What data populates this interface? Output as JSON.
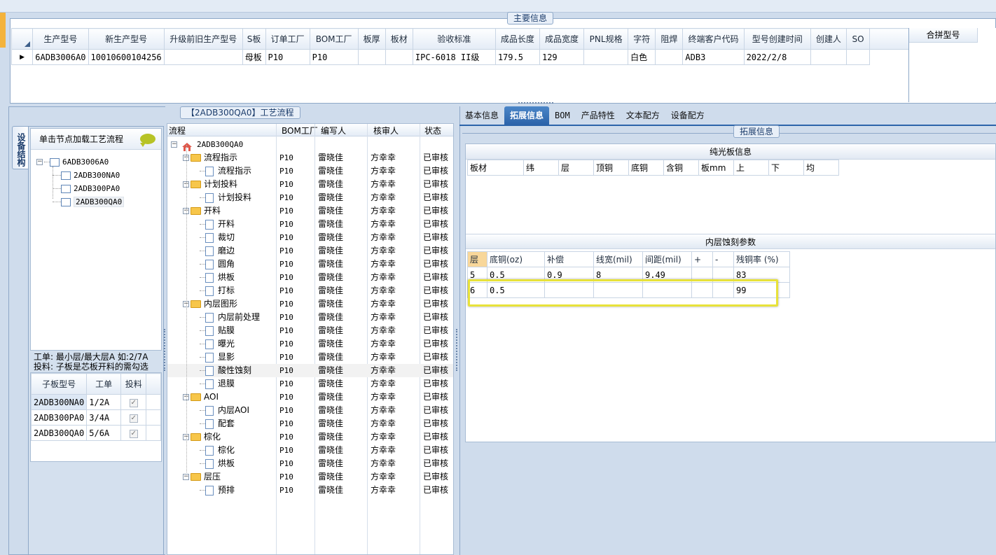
{
  "main_group": {
    "title": "主要信息",
    "columns": [
      "生产型号",
      "新生产型号",
      "升级前旧生产型号",
      "S板",
      "订单工厂",
      "BOM工厂",
      "板厚",
      "板材",
      "验收标准",
      "成品长度",
      "成品宽度",
      "PNL规格",
      "字符",
      "阻焊",
      "终端客户代码",
      "型号创建时间",
      "创建人",
      "SO"
    ],
    "row": [
      "6ADB3006A0",
      "10010600104256",
      "",
      "母板",
      "P10",
      "P10",
      "",
      "",
      "IPC-6018 II级",
      "179.5",
      "129",
      "",
      "白色",
      "",
      "ADB3",
      "2022/2/8",
      "",
      ""
    ],
    "merge_header": "合拼型号"
  },
  "left_panel": {
    "vtab": "设备结构",
    "hint": "单击节点加载工艺流程",
    "tree": {
      "root": "6ADB3006A0",
      "children": [
        "2ADB300NA0",
        "2ADB300PA0",
        "2ADB300QA0"
      ]
    },
    "note1": "工单: 最小层/最大层A 如:2/7A",
    "note2": "投料: 子板是芯板开料的需勾选",
    "sub_cols": [
      "子板型号",
      "工单",
      "投料"
    ],
    "sub_rows": [
      {
        "model": "2ADB300NA0",
        "order": "1/2A",
        "check": "✓"
      },
      {
        "model": "2ADB300PA0",
        "order": "3/4A",
        "check": "✓"
      },
      {
        "model": "2ADB300QA0",
        "order": "5/6A",
        "check": "✓"
      }
    ]
  },
  "flow": {
    "title": "【2ADB300QA0】工艺流程",
    "cols": [
      "流程",
      "BOM工厂",
      "编写人",
      "核审人",
      "状态"
    ],
    "root": "2ADB300QA0",
    "rows": [
      {
        "name": "流程指示",
        "level": 1,
        "factory": "P10",
        "writer": "雷晓佳",
        "reviewer": "方幸幸",
        "status": "已审核"
      },
      {
        "name": "流程指示",
        "level": 2,
        "factory": "P10",
        "writer": "雷晓佳",
        "reviewer": "方幸幸",
        "status": "已审核"
      },
      {
        "name": "计划投料",
        "level": 1,
        "factory": "P10",
        "writer": "雷晓佳",
        "reviewer": "方幸幸",
        "status": "已审核"
      },
      {
        "name": "计划投料",
        "level": 2,
        "factory": "P10",
        "writer": "雷晓佳",
        "reviewer": "方幸幸",
        "status": "已审核"
      },
      {
        "name": "开料",
        "level": 1,
        "factory": "P10",
        "writer": "雷晓佳",
        "reviewer": "方幸幸",
        "status": "已审核"
      },
      {
        "name": "开料",
        "level": 2,
        "factory": "P10",
        "writer": "雷晓佳",
        "reviewer": "方幸幸",
        "status": "已审核"
      },
      {
        "name": "裁切",
        "level": 2,
        "factory": "P10",
        "writer": "雷晓佳",
        "reviewer": "方幸幸",
        "status": "已审核"
      },
      {
        "name": "磨边",
        "level": 2,
        "factory": "P10",
        "writer": "雷晓佳",
        "reviewer": "方幸幸",
        "status": "已审核"
      },
      {
        "name": "圆角",
        "level": 2,
        "factory": "P10",
        "writer": "雷晓佳",
        "reviewer": "方幸幸",
        "status": "已审核"
      },
      {
        "name": "烘板",
        "level": 2,
        "factory": "P10",
        "writer": "雷晓佳",
        "reviewer": "方幸幸",
        "status": "已审核"
      },
      {
        "name": "打标",
        "level": 2,
        "factory": "P10",
        "writer": "雷晓佳",
        "reviewer": "方幸幸",
        "status": "已审核"
      },
      {
        "name": "内层图形",
        "level": 1,
        "factory": "P10",
        "writer": "雷晓佳",
        "reviewer": "方幸幸",
        "status": "已审核"
      },
      {
        "name": "内层前处理",
        "level": 2,
        "factory": "P10",
        "writer": "雷晓佳",
        "reviewer": "方幸幸",
        "status": "已审核"
      },
      {
        "name": "贴膜",
        "level": 2,
        "factory": "P10",
        "writer": "雷晓佳",
        "reviewer": "方幸幸",
        "status": "已审核"
      },
      {
        "name": "曝光",
        "level": 2,
        "factory": "P10",
        "writer": "雷晓佳",
        "reviewer": "方幸幸",
        "status": "已审核"
      },
      {
        "name": "显影",
        "level": 2,
        "factory": "P10",
        "writer": "雷晓佳",
        "reviewer": "方幸幸",
        "status": "已审核"
      },
      {
        "name": "酸性蚀刻",
        "level": 2,
        "factory": "P10",
        "writer": "雷晓佳",
        "reviewer": "方幸幸",
        "status": "已审核"
      },
      {
        "name": "退膜",
        "level": 2,
        "factory": "P10",
        "writer": "雷晓佳",
        "reviewer": "方幸幸",
        "status": "已审核"
      },
      {
        "name": "AOI",
        "level": 1,
        "factory": "P10",
        "writer": "雷晓佳",
        "reviewer": "方幸幸",
        "status": "已审核"
      },
      {
        "name": "内层AOI",
        "level": 2,
        "factory": "P10",
        "writer": "雷晓佳",
        "reviewer": "方幸幸",
        "status": "已审核"
      },
      {
        "name": "配套",
        "level": 2,
        "factory": "P10",
        "writer": "雷晓佳",
        "reviewer": "方幸幸",
        "status": "已审核"
      },
      {
        "name": "棕化",
        "level": 1,
        "factory": "P10",
        "writer": "雷晓佳",
        "reviewer": "方幸幸",
        "status": "已审核"
      },
      {
        "name": "棕化",
        "level": 2,
        "factory": "P10",
        "writer": "雷晓佳",
        "reviewer": "方幸幸",
        "status": "已审核"
      },
      {
        "name": "烘板",
        "level": 2,
        "factory": "P10",
        "writer": "雷晓佳",
        "reviewer": "方幸幸",
        "status": "已审核"
      },
      {
        "name": "层压",
        "level": 1,
        "factory": "P10",
        "writer": "雷晓佳",
        "reviewer": "方幸幸",
        "status": "已审核"
      },
      {
        "name": "预排",
        "level": 2,
        "factory": "P10",
        "writer": "雷晓佳",
        "reviewer": "方幸幸",
        "status": "已审核"
      }
    ]
  },
  "right": {
    "tabs": [
      "基本信息",
      "拓展信息",
      "BOM",
      "产品特性",
      "文本配方",
      "设备配方"
    ],
    "group_title": "拓展信息",
    "plain_title": "纯光板信息",
    "plain_cols": [
      "板材",
      "纬",
      "层",
      "顶铜",
      "底铜",
      "含铜",
      "板mm",
      "上",
      "下",
      "均"
    ],
    "etch_title": "内层蚀刻参数",
    "etch_cols": [
      "层",
      "底铜(oz)",
      "补偿",
      "线宽(mil)",
      "间距(mil)",
      "+",
      "-",
      "残铜率 (%)"
    ],
    "etch_rows": [
      [
        "5",
        "0.5",
        "0.9",
        "8",
        "9.49",
        "",
        "",
        "83"
      ],
      [
        "6",
        "0.5",
        "",
        "",
        "",
        "",
        "",
        "99"
      ]
    ]
  },
  "colors": {
    "accent": "#2c64aa",
    "highlight": "#e8e23a",
    "frame": "#8ea8c8"
  }
}
